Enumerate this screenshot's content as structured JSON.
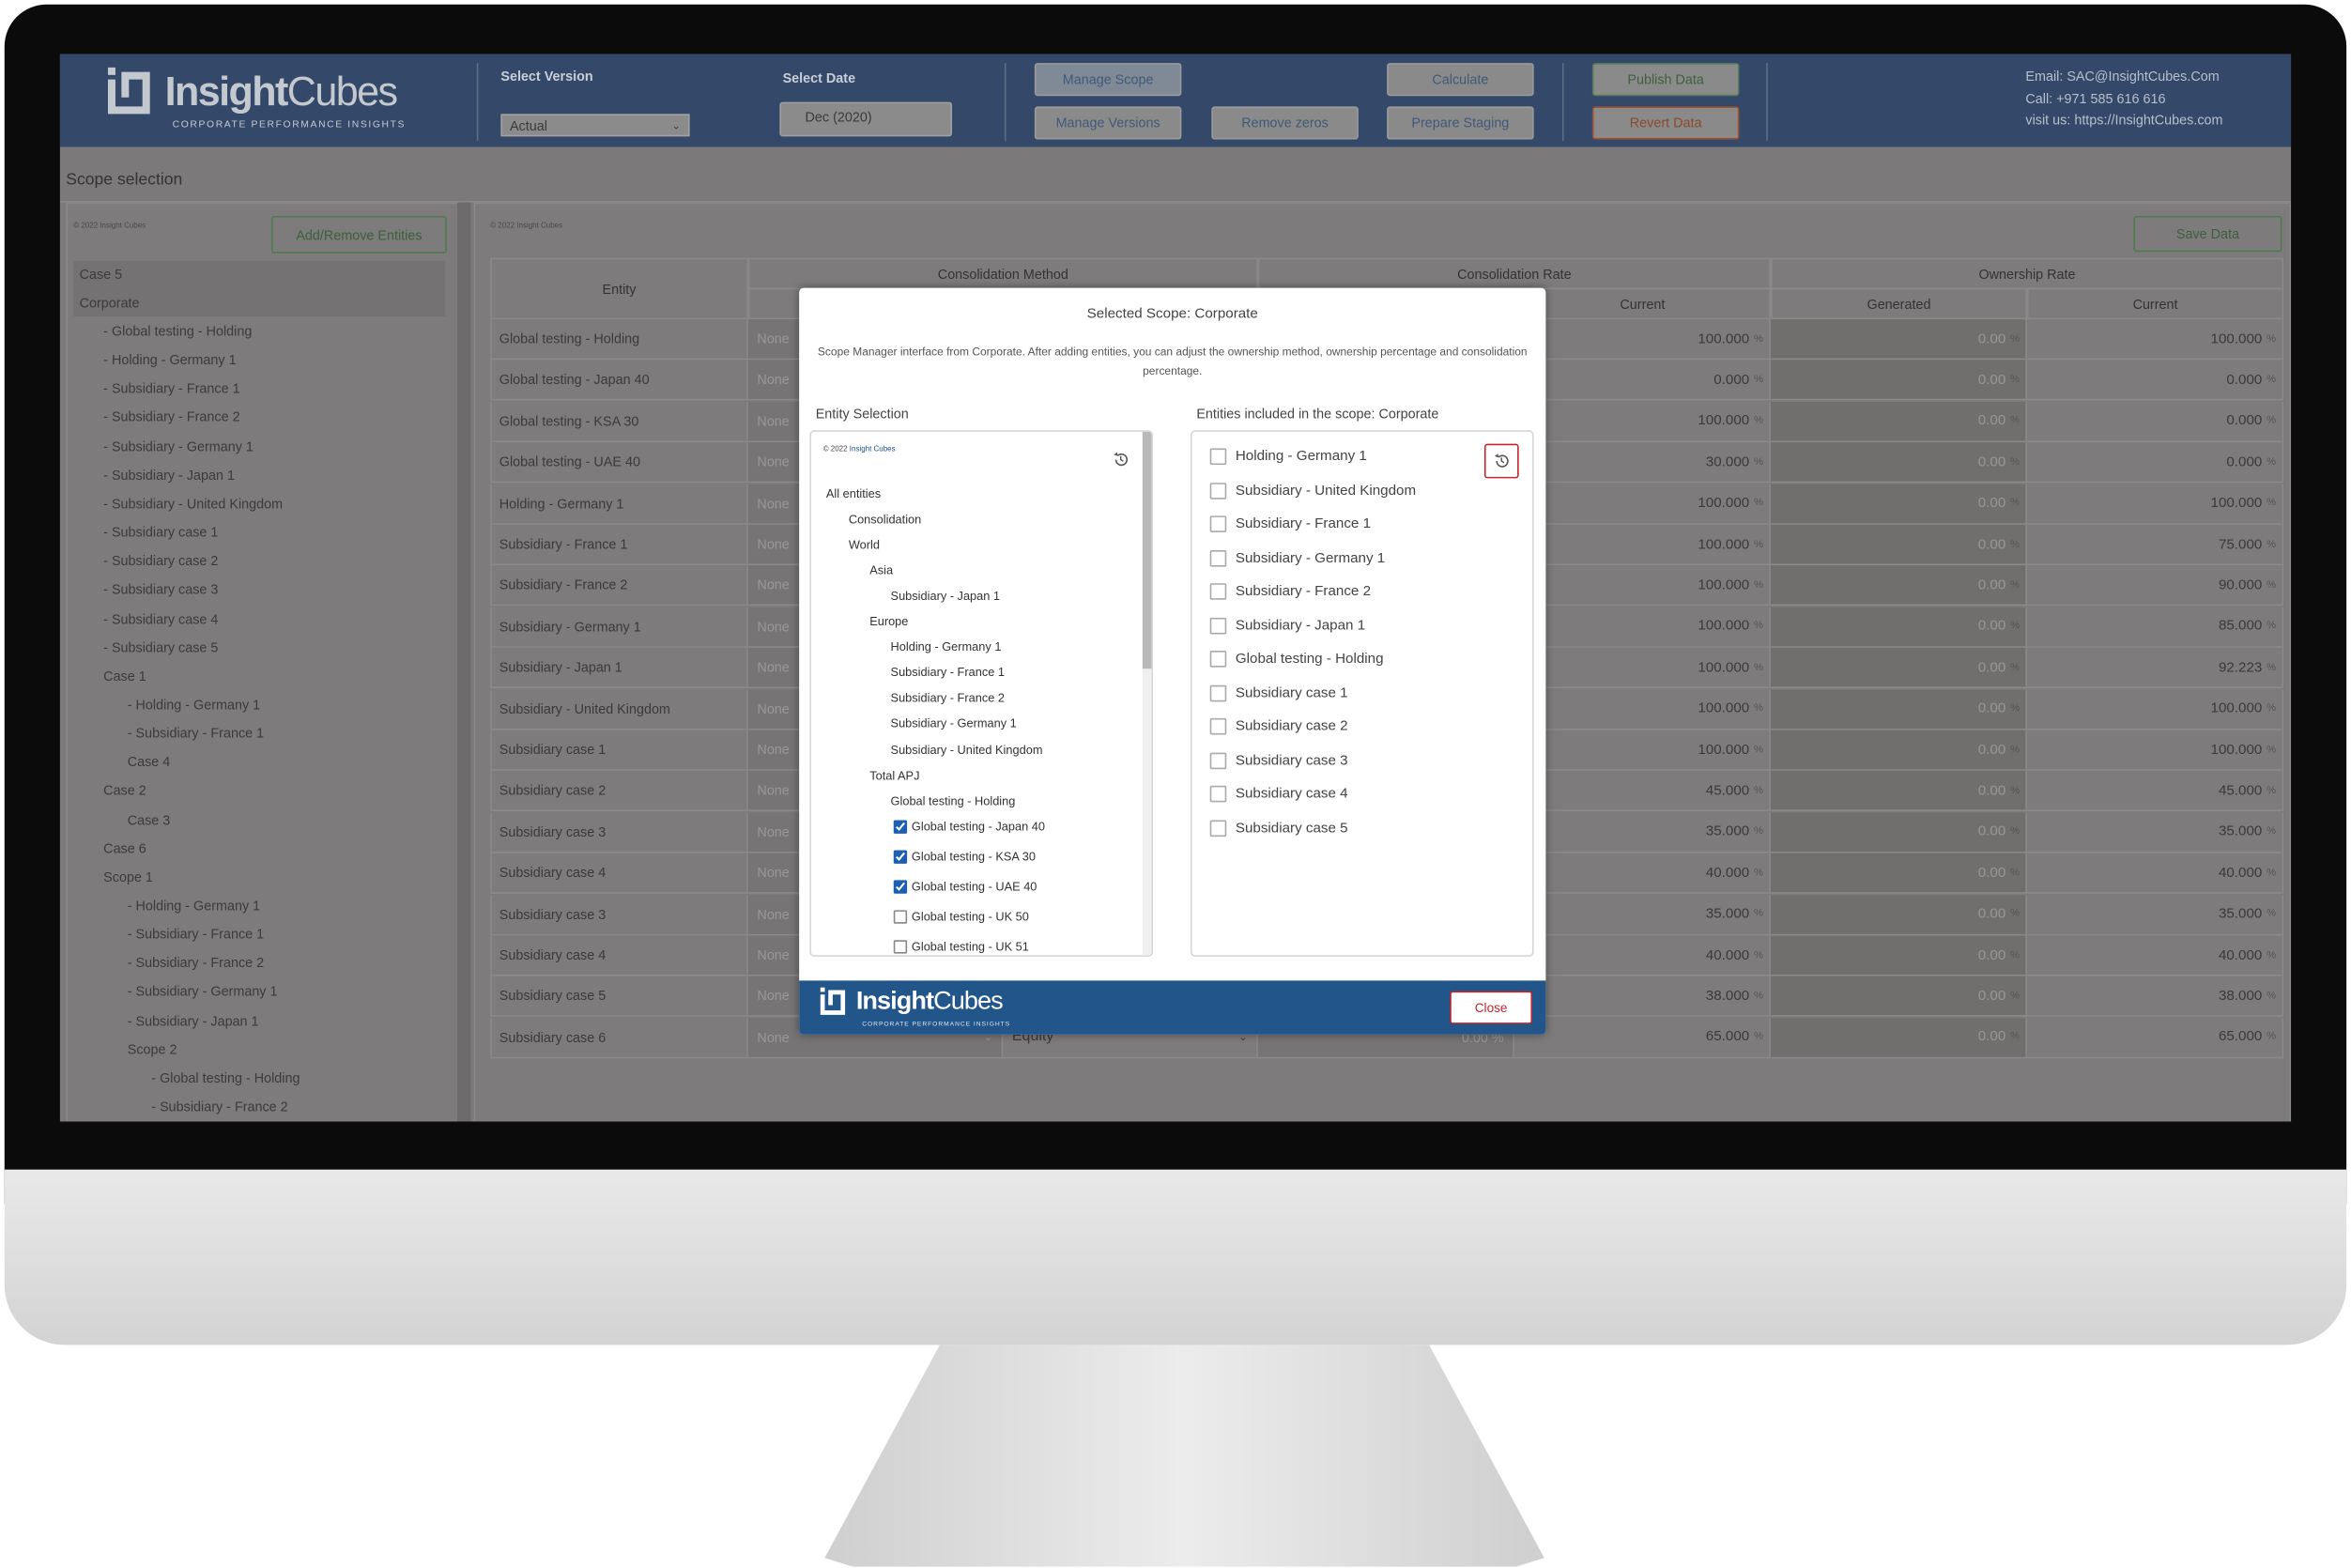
{
  "header": {
    "brand_bold": "Insight",
    "brand_light": "Cubes",
    "brand_tagline": "CORPORATE PERFORMANCE INSIGHTS",
    "select_version_label": "Select Version",
    "select_version_value": "Actual",
    "select_date_label": "Select Date",
    "select_date_value": "Dec (2020)",
    "buttons": {
      "manage_scope": "Manage Scope",
      "manage_versions": "Manage Versions",
      "remove_zeros": "Remove zeros",
      "calculate": "Calculate",
      "prepare_staging": "Prepare Staging",
      "publish_data": "Publish Data",
      "revert_data": "Revert Data"
    },
    "contact": {
      "email": "Email: SAC@InsightCubes.Com",
      "call": "Call: +971 585 616 616",
      "visit": "visit us: https://InsightCubes.com"
    }
  },
  "page_title": "Scope selection",
  "left_panel": {
    "copyright": "© 2022 Insight Cubes",
    "add_remove_button": "Add/Remove Entities",
    "selected": [
      "Case 5",
      "Corporate"
    ],
    "items": [
      {
        "label": "- Global testing - Holding",
        "level": 1
      },
      {
        "label": "- Holding - Germany 1",
        "level": 1
      },
      {
        "label": "- Subsidiary - France 1",
        "level": 1
      },
      {
        "label": "- Subsidiary - France 2",
        "level": 1
      },
      {
        "label": "- Subsidiary - Germany 1",
        "level": 1
      },
      {
        "label": "- Subsidiary - Japan 1",
        "level": 1
      },
      {
        "label": "- Subsidiary - United Kingdom",
        "level": 1
      },
      {
        "label": "- Subsidiary case 1",
        "level": 1
      },
      {
        "label": "- Subsidiary case 2",
        "level": 1
      },
      {
        "label": "- Subsidiary case 3",
        "level": 1
      },
      {
        "label": "- Subsidiary case 4",
        "level": 1
      },
      {
        "label": "- Subsidiary case 5",
        "level": 1
      },
      {
        "label": "Case 1",
        "level": 1
      },
      {
        "label": "- Holding - Germany 1",
        "level": 2
      },
      {
        "label": "- Subsidiary - France 1",
        "level": 2
      },
      {
        "label": "Case 4",
        "level": 2
      },
      {
        "label": "Case 2",
        "level": 1
      },
      {
        "label": "Case 3",
        "level": 2
      },
      {
        "label": "Case 6",
        "level": 1
      },
      {
        "label": "Scope 1",
        "level": 1
      },
      {
        "label": "- Holding - Germany 1",
        "level": 2
      },
      {
        "label": "- Subsidiary - France 1",
        "level": 2
      },
      {
        "label": "- Subsidiary - France 2",
        "level": 2
      },
      {
        "label": "- Subsidiary - Germany 1",
        "level": 2
      },
      {
        "label": "- Subsidiary - Japan 1",
        "level": 2
      },
      {
        "label": "Scope 2",
        "level": 2
      },
      {
        "label": "- Global testing - Holding",
        "level": 3
      },
      {
        "label": "- Subsidiary - France 2",
        "level": 3
      }
    ]
  },
  "right_panel": {
    "copyright": "© 2022 Insight Cubes",
    "save_button": "Save Data",
    "columns": {
      "entity": "Entity",
      "consolidation_method": "Consolidation Method",
      "consolidation_rate": "Consolidation Rate",
      "consolidation_rate_current": "Current",
      "ownership_rate": "Ownership Rate",
      "ownership_generated": "Generated",
      "ownership_current": "Current"
    },
    "percent_sign": "%",
    "rows": [
      {
        "entity": "Global testing - Holding",
        "method": "None",
        "cons_current": "100.000",
        "own_generated": "0.00",
        "own_current": "100.000"
      },
      {
        "entity": "Global testing - Japan 40",
        "method": "None",
        "cons_current": "0.000",
        "own_generated": "0.00",
        "own_current": "0.000"
      },
      {
        "entity": "Global testing - KSA 30",
        "method": "None",
        "cons_current": "100.000",
        "own_generated": "0.00",
        "own_current": "0.000"
      },
      {
        "entity": "Global testing - UAE 40",
        "method": "None",
        "cons_current": "30.000",
        "own_generated": "0.00",
        "own_current": "0.000"
      },
      {
        "entity": "Holding - Germany 1",
        "method": "None",
        "cons_current": "100.000",
        "own_generated": "0.00",
        "own_current": "100.000"
      },
      {
        "entity": "Subsidiary - France 1",
        "method": "None",
        "cons_current": "100.000",
        "own_generated": "0.00",
        "own_current": "75.000"
      },
      {
        "entity": "Subsidiary - France 2",
        "method": "None",
        "cons_current": "100.000",
        "own_generated": "0.00",
        "own_current": "90.000"
      },
      {
        "entity": "Subsidiary - Germany 1",
        "method": "None",
        "cons_current": "100.000",
        "own_generated": "0.00",
        "own_current": "85.000"
      },
      {
        "entity": "Subsidiary - Japan 1",
        "method": "None",
        "cons_current": "100.000",
        "own_generated": "0.00",
        "own_current": "92.223"
      },
      {
        "entity": "Subsidiary - United Kingdom",
        "method": "None",
        "cons_current": "100.000",
        "own_generated": "0.00",
        "own_current": "100.000"
      },
      {
        "entity": "Subsidiary case 1",
        "method": "None",
        "cons_current": "100.000",
        "own_generated": "0.00",
        "own_current": "100.000"
      },
      {
        "entity": "Subsidiary case 2",
        "method": "None",
        "cons_current": "45.000",
        "own_generated": "0.00",
        "own_current": "45.000"
      },
      {
        "entity": "Subsidiary case 3",
        "method": "None",
        "cons_current": "35.000",
        "own_generated": "0.00",
        "own_current": "35.000"
      },
      {
        "entity": "Subsidiary case 4",
        "method": "None",
        "cons_current": "40.000",
        "own_generated": "0.00",
        "own_current": "40.000"
      },
      {
        "entity": "Subsidiary case 3",
        "method": "None",
        "cons_current": "35.000",
        "own_generated": "0.00",
        "own_current": "35.000"
      },
      {
        "entity": "Subsidiary case 4",
        "method": "None",
        "cons_current": "40.000",
        "own_generated": "0.00",
        "own_current": "40.000"
      },
      {
        "entity": "Subsidiary case 5",
        "method": "None",
        "cons_current": "38.000",
        "own_generated": "0.00",
        "own_current": "38.000"
      },
      {
        "entity": "Subsidiary case 6",
        "method": "None",
        "method_current": "Equity",
        "cons_generated": "0.00 %",
        "cons_current": "65.000",
        "own_generated": "0.00",
        "own_current": "65.000"
      }
    ]
  },
  "modal": {
    "title": "Selected Scope: Corporate",
    "description": "Scope Manager interface from Corporate. After adding entities, you can adjust the ownership method, ownership percentage and consolidation percentage.",
    "entity_selection_title": "Entity Selection",
    "included_title": "Entities included in the scope: Corporate",
    "copyright_prefix": "© 2022 ",
    "copyright_link": "Insight Cubes",
    "tree": [
      {
        "label": "All entities",
        "level": 0
      },
      {
        "label": "Consolidation",
        "level": 1
      },
      {
        "label": "World",
        "level": 1
      },
      {
        "label": "Asia",
        "level": 2
      },
      {
        "label": "Subsidiary - Japan 1",
        "level": 3
      },
      {
        "label": "Europe",
        "level": 2
      },
      {
        "label": "Holding - Germany 1",
        "level": 3
      },
      {
        "label": "Subsidiary - France 1",
        "level": 3
      },
      {
        "label": "Subsidiary - France 2",
        "level": 3
      },
      {
        "label": "Subsidiary - Germany 1",
        "level": 3
      },
      {
        "label": "Subsidiary - United Kingdom",
        "level": 3
      },
      {
        "label": "Total APJ",
        "level": 2
      },
      {
        "label": "Global testing - Holding",
        "level": 3
      },
      {
        "label": "Global testing - Japan 40",
        "level": 3,
        "checked": true
      },
      {
        "label": "Global testing - KSA 30",
        "level": 3,
        "checked": true
      },
      {
        "label": "Global testing - UAE 40",
        "level": 3,
        "checked": true
      },
      {
        "label": "Global testing - UK 50",
        "level": 3,
        "checked": false
      },
      {
        "label": "Global testing - UK 51",
        "level": 3,
        "checked": false
      }
    ],
    "included": [
      "Holding - Germany 1",
      "Subsidiary - United Kingdom",
      "Subsidiary - France 1",
      "Subsidiary - Germany 1",
      "Subsidiary - France 2",
      "Subsidiary - Japan 1",
      "Global testing - Holding",
      "Subsidiary case 1",
      "Subsidiary case 2",
      "Subsidiary case 3",
      "Subsidiary case 4",
      "Subsidiary case 5"
    ],
    "close_button": "Close",
    "footer_brand_bold": "Insight",
    "footer_brand_light": "Cubes",
    "footer_tagline": "CORPORATE PERFORMANCE INSIGHTS"
  },
  "colors": {
    "header_bg": "#34496a",
    "modal_footer": "#22558a",
    "checkbox_checked": "#1c5fb3",
    "close_accent": "#c0262c"
  },
  "icons": [
    "history-icon",
    "chevron-right-icon",
    "chevron-left-icon",
    "chevron-down-icon",
    "insightcubes-logo"
  ]
}
